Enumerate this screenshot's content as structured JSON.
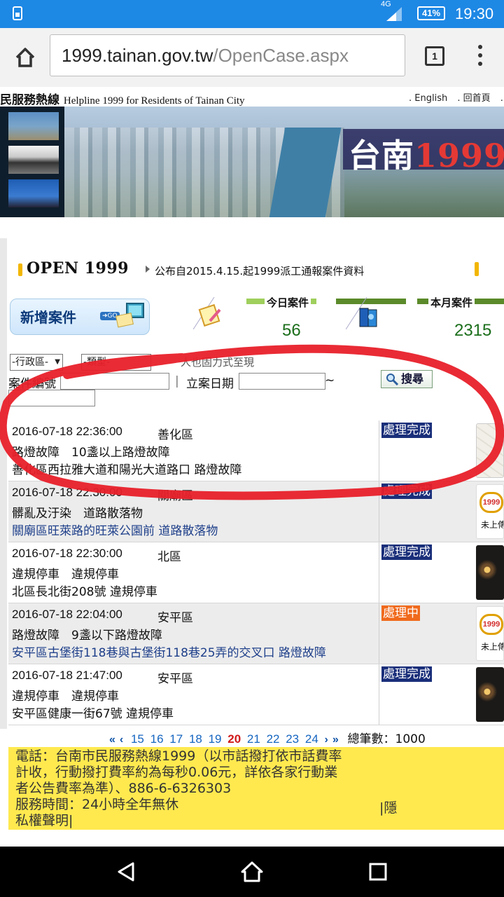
{
  "status_bar": {
    "network": "4G",
    "battery": "41%",
    "time": "19:30"
  },
  "browser": {
    "url_domain": "1999.tainan.gov.tw",
    "url_path": "/OpenCase.aspx",
    "tab_count": "1"
  },
  "header": {
    "site_title": "民服務熱線",
    "site_title_en": "Helpline 1999 for Residents of Tainan City",
    "links": [
      ". English",
      ". 回首頁",
      ". 網"
    ]
  },
  "banner": {
    "logo_text": "台南",
    "logo_num": "1999"
  },
  "open_section": {
    "title": "OPEN 1999",
    "description": "公布自2015.4.15.起1999派工通報案件資料"
  },
  "new_case": {
    "label": "新增案件",
    "go": "GO"
  },
  "stats": {
    "today_label": "今日案件",
    "today_value": "56",
    "month_label": "本月案件",
    "month_value": "2315"
  },
  "search": {
    "district_select": "-行政區-",
    "category_select": "-類型-",
    "obscured_text": "人也固力式至現",
    "case_no_label": "案件編號",
    "date_label": "立案日期",
    "tilde": "~",
    "button_label": "搜尋"
  },
  "cases": [
    {
      "datetime": "2016-07-18 22:36:00",
      "district": "善化區",
      "type": "路燈故障　10盞以上路燈故障",
      "address": "善化區西拉雅大道和陽光大道路口 路燈故障",
      "status": "處理完成"
    },
    {
      "datetime": "2016-07-18 22:30:00",
      "district": "關廟區",
      "type": "髒亂及汙染　道路散落物",
      "address": "關廟區旺萊路的旺萊公園前 道路散落物",
      "status": "處理完成",
      "nophoto": "未上傳"
    },
    {
      "datetime": "2016-07-18 22:30:00",
      "district": "北區",
      "type": "違規停車　違規停車",
      "address": "北區長北街208號 違規停車",
      "status": "處理完成"
    },
    {
      "datetime": "2016-07-18 22:04:00",
      "district": "安平區",
      "type": "路燈故障　9盞以下路燈故障",
      "address": "安平區古堡街118巷與古堡街118巷25弄的交叉口 路燈故障",
      "status": "處理中",
      "nophoto": "未上傳"
    },
    {
      "datetime": "2016-07-18 21:47:00",
      "district": "安平區",
      "type": "違規停車　違規停車",
      "address": "安平區健康一街67號 違規停車",
      "status": "處理完成"
    }
  ],
  "pager": {
    "pages": [
      "15",
      "16",
      "17",
      "18",
      "19",
      "20",
      "21",
      "22",
      "23",
      "24"
    ],
    "current": "20",
    "total_label": "總筆數：1000"
  },
  "footer": {
    "lines": [
      "電話：台南市民服務熱線1999（以市話撥打依市話費率",
      "計收，行動撥打費率約為每秒0.06元，詳依各家行動業",
      "者公告費率為準）、886-6-6326303",
      "服務時間：24小時全年無休",
      "私權聲明|"
    ],
    "privacy_link": "|隱"
  },
  "colors": {
    "status_done": "#1a2f7a",
    "status_progress": "#f06a1c",
    "footer_bg": "#ffe94f",
    "annotation": "#e8202a"
  }
}
